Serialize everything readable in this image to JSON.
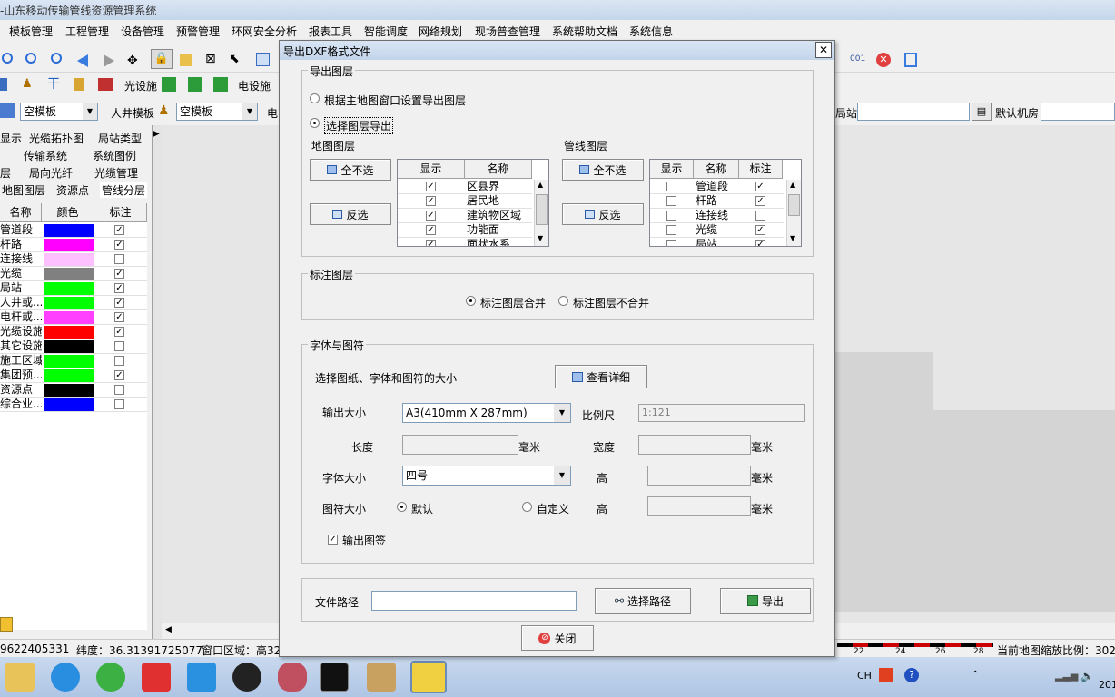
{
  "app": {
    "title": "-山东移动传输管线资源管理系统"
  },
  "menu": [
    "模板管理",
    "工程管理",
    "设备管理",
    "预警管理",
    "环网安全分析",
    "报表工具",
    "智能调度",
    "网络规划",
    "现场普查管理",
    "系统帮助文档",
    "系统信息"
  ],
  "toolbar": {
    "guangsheshi": "光设施",
    "dianshesi": "电设施",
    "template1": "空模板",
    "manhole_label": "人井模板",
    "template2": "空模板",
    "dian_cut": "电",
    "jz_label": "局站",
    "room_label": "默认机房"
  },
  "left_tabs": {
    "row1": [
      "显示",
      "光缆拓扑图",
      "局站类型"
    ],
    "row2": [
      "传输系统",
      "系统图例"
    ],
    "row3": [
      "层",
      "局向光纤",
      "光缆管理"
    ],
    "row4": [
      "地图图层",
      "资源点",
      "管线分层"
    ]
  },
  "left_grid": {
    "headers": [
      "名称",
      "颜色",
      "标注"
    ],
    "rows": [
      {
        "name": "管道段",
        "color": "#0000ff",
        "checked": true
      },
      {
        "name": "杆路",
        "color": "#ff00ff",
        "checked": true
      },
      {
        "name": "连接线",
        "color": "#ffc0ff",
        "checked": false
      },
      {
        "name": "光缆",
        "color": "#808080",
        "checked": true
      },
      {
        "name": "局站",
        "color": "#00ff00",
        "checked": true
      },
      {
        "name": "人井或...",
        "color": "#00ff00",
        "checked": true
      },
      {
        "name": "电杆或...",
        "color": "#ff40ff",
        "checked": true
      },
      {
        "name": "光缆设施",
        "color": "#ff0000",
        "checked": true
      },
      {
        "name": "其它设施",
        "color": "#000000",
        "checked": false
      },
      {
        "name": "施工区域",
        "color": "#00ff00",
        "checked": false
      },
      {
        "name": "集团预...",
        "color": "#00ff00",
        "checked": true
      },
      {
        "name": "资源点",
        "color": "#000000",
        "checked": false
      },
      {
        "name": "综合业...",
        "color": "#0000ff",
        "checked": false
      }
    ]
  },
  "statusbar": {
    "coord": "9622405331",
    "lat": "纬度：36.31391725077",
    "window": "窗口区域：高32",
    "scale_ticks": [
      "22",
      "24",
      "26",
      "28"
    ],
    "scale": "当前地图缩放比例：302"
  },
  "dialog": {
    "title": "导出DXF格式文件",
    "close_glyph": "✕",
    "export_group": "导出图层",
    "radio_main": "根据主地图窗口设置导出图层",
    "radio_select": "选择图层导出",
    "map_layers_label": "地图图层",
    "pipe_layers_label": "管线图层",
    "select_none": "全不选",
    "invert": "反选",
    "map_grid": {
      "headers": [
        "显示",
        "名称"
      ],
      "rows": [
        {
          "show": true,
          "name": "区县界"
        },
        {
          "show": true,
          "name": "居民地"
        },
        {
          "show": true,
          "name": "建筑物区域"
        },
        {
          "show": true,
          "name": "功能面"
        },
        {
          "show": true,
          "name": "面状水系"
        }
      ]
    },
    "pipe_grid": {
      "headers": [
        "显示",
        "名称",
        "标注"
      ],
      "rows": [
        {
          "show": false,
          "name": "管道段",
          "mark": true
        },
        {
          "show": false,
          "name": "杆路",
          "mark": true
        },
        {
          "show": false,
          "name": "连接线",
          "mark": false
        },
        {
          "show": false,
          "name": "光缆",
          "mark": true
        },
        {
          "show": false,
          "name": "局站",
          "mark": true
        }
      ]
    },
    "label_group": "标注图层",
    "merge": "标注图层合并",
    "no_merge": "标注图层不合并",
    "font_group": "字体与图符",
    "font_desc": "选择图纸、字体和图符的大小",
    "view_detail": "查看详细",
    "output_size_label": "输出大小",
    "output_size": "A3(410mm X 287mm)",
    "scale_label": "比例尺",
    "scale_value": "1:121",
    "length_label": "长度",
    "width_label": "宽度",
    "mm": "毫米",
    "font_size_label": "字体大小",
    "font_size": "四号",
    "height_label": "高",
    "symbol_size_label": "图符大小",
    "default": "默认",
    "custom": "自定义",
    "output_sign": "输出图签",
    "path_label": "文件路径",
    "choose_path": "选择路径",
    "export": "导出",
    "close": "关闭"
  },
  "taskbar": {
    "lang": "CH",
    "clock": "201"
  }
}
